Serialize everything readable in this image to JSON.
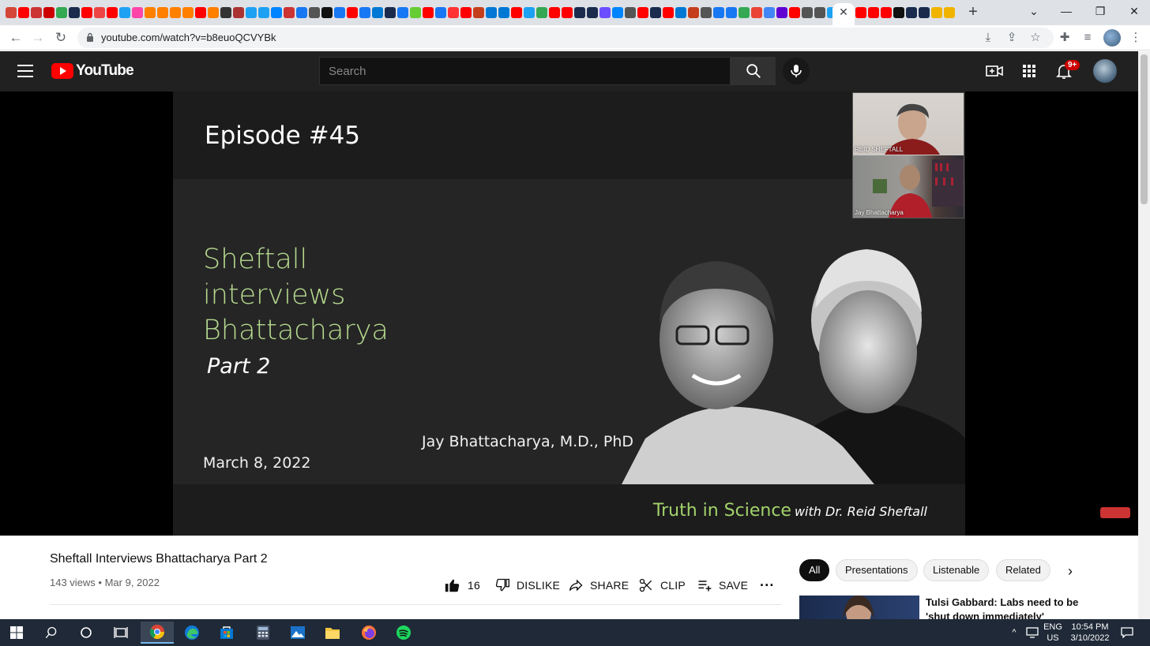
{
  "browser": {
    "url": "youtube.com/watch?v=b8euoQCVYBk",
    "favicon_colors": [
      "#d44638",
      "#ff0000",
      "#c33",
      "#cc0000",
      "#34a853",
      "#1a2b4d",
      "#ff0000",
      "#e44",
      "#ff0000",
      "#1da1f2",
      "#f4a",
      "#ff7f00",
      "#ff7f00",
      "#ff7f00",
      "#ff7f00",
      "#ff0000",
      "#ff7f00",
      "#333",
      "#aa3333",
      "#1da1f2",
      "#1da1f2",
      "#0084ff",
      "#c33",
      "#1877f2",
      "#555",
      "#111",
      "#1877f2",
      "#ff0000",
      "#1877f2",
      "#0078d4",
      "#1a2b4d",
      "#1877f2",
      "#6c3",
      "#ff0000",
      "#1877f2",
      "#f33",
      "#ff0000",
      "#c43e1c",
      "#0078d4",
      "#0078d4",
      "#ff0000",
      "#1da1f2",
      "#34a853",
      "#ff0000",
      "#ff0000",
      "#1a2b4d",
      "#1a2b4d",
      "#6b4cff",
      "#0084ff",
      "#555",
      "#ff0000",
      "#1a2b4d",
      "#ff0000",
      "#0078d4",
      "#c43e1c",
      "#555",
      "#1877f2",
      "#1877f2",
      "#34a853",
      "#ea4335",
      "#4285f4",
      "#6001d2",
      "#ff0000",
      "#555",
      "#555",
      "#1da1f2",
      "#ff0000"
    ],
    "favicon_colors_right": [
      "#ff0000",
      "#ff0000",
      "#ff0000",
      "#111",
      "#1a2b4d",
      "#1a2b4d",
      "#f0b400",
      "#f0b400"
    ]
  },
  "youtube": {
    "logo_text": "YouTube",
    "search_placeholder": "Search",
    "notification_count": "9+"
  },
  "video": {
    "slide": {
      "episode": "Episode #45",
      "title_lines": [
        "Sheftall",
        "interviews",
        "Bhattacharya"
      ],
      "part": "Part 2",
      "guest": "Jay Bhattacharya, M.D., PhD",
      "date": "March 8, 2022",
      "brand_main": "Truth in Science",
      "brand_sub": "with Dr. Reid Sheftall"
    },
    "pip": {
      "top_name": "REID SHEFTALL",
      "bottom_name": "Jay Bhattacharya"
    },
    "title": "Sheftall Interviews Bhattacharya Part 2",
    "views": "143 views",
    "date": "Mar 9, 2022",
    "likes": "16",
    "actions": {
      "dislike": "DISLIKE",
      "share": "SHARE",
      "clip": "CLIP",
      "save": "SAVE"
    }
  },
  "sidebar": {
    "chips": [
      "All",
      "Presentations",
      "Listenable",
      "Related"
    ],
    "recommendation_title": "Tulsi Gabbard: Labs need to be 'shut down immediately'"
  },
  "taskbar": {
    "language": "ENG",
    "region": "US",
    "time": "10:54 PM",
    "date": "3/10/2022"
  }
}
